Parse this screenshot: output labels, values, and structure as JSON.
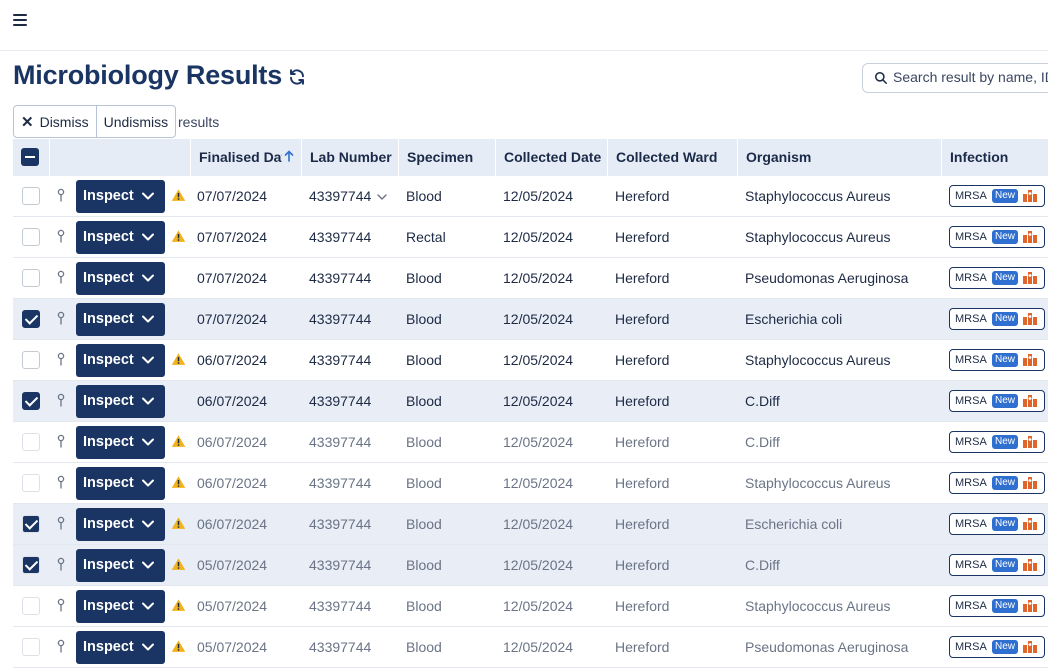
{
  "header": {
    "menu_icon": "hamburger-icon"
  },
  "page": {
    "title": "Microbiology Results",
    "refresh_icon": "refresh-icon"
  },
  "search": {
    "placeholder": "Search result by name, ID",
    "value": ""
  },
  "actions": {
    "dismiss_label": "Dismiss",
    "undismiss_label": "Undismiss",
    "results_label": "results"
  },
  "table": {
    "columns": [
      "Finalised Date",
      "Lab Number",
      "Specimen",
      "Collected Date",
      "Collected Ward",
      "Organism",
      "Infection"
    ],
    "inspect_label": "Inspect",
    "rows": [
      {
        "checked": false,
        "warning": true,
        "faded": false,
        "finalised": "07/07/2024",
        "lab": "43397744",
        "lab_dropdown": true,
        "specimen": "Blood",
        "collected": "12/05/2024",
        "ward": "Hereford",
        "organism": "Staphylococcus Aureus",
        "infection": "MRSA",
        "badge": "New"
      },
      {
        "checked": false,
        "warning": true,
        "faded": false,
        "finalised": "07/07/2024",
        "lab": "43397744",
        "lab_dropdown": false,
        "specimen": "Rectal",
        "collected": "12/05/2024",
        "ward": "Hereford",
        "organism": "Staphylococcus Aureus",
        "infection": "MRSA",
        "badge": "New"
      },
      {
        "checked": false,
        "warning": false,
        "faded": false,
        "finalised": "07/07/2024",
        "lab": "43397744",
        "lab_dropdown": false,
        "specimen": "Blood",
        "collected": "12/05/2024",
        "ward": "Hereford",
        "organism": "Pseudomonas Aeruginosa",
        "infection": "MRSA",
        "badge": "New"
      },
      {
        "checked": true,
        "warning": false,
        "faded": false,
        "finalised": "07/07/2024",
        "lab": "43397744",
        "lab_dropdown": false,
        "specimen": "Blood",
        "collected": "12/05/2024",
        "ward": "Hereford",
        "organism": "Escherichia coli",
        "infection": "MRSA",
        "badge": "New"
      },
      {
        "checked": false,
        "warning": true,
        "faded": false,
        "finalised": "06/07/2024",
        "lab": "43397744",
        "lab_dropdown": false,
        "specimen": "Blood",
        "collected": "12/05/2024",
        "ward": "Hereford",
        "organism": "Staphylococcus Aureus",
        "infection": "MRSA",
        "badge": "New"
      },
      {
        "checked": true,
        "warning": false,
        "faded": false,
        "finalised": "06/07/2024",
        "lab": "43397744",
        "lab_dropdown": false,
        "specimen": "Blood",
        "collected": "12/05/2024",
        "ward": "Hereford",
        "organism": "C.Diff",
        "infection": "MRSA",
        "badge": "New"
      },
      {
        "checked": false,
        "warning": true,
        "faded": true,
        "finalised": "06/07/2024",
        "lab": "43397744",
        "lab_dropdown": false,
        "specimen": "Blood",
        "collected": "12/05/2024",
        "ward": "Hereford",
        "organism": "C.Diff",
        "infection": "MRSA",
        "badge": "New"
      },
      {
        "checked": false,
        "warning": true,
        "faded": true,
        "finalised": "06/07/2024",
        "lab": "43397744",
        "lab_dropdown": false,
        "specimen": "Blood",
        "collected": "12/05/2024",
        "ward": "Hereford",
        "organism": "Staphylococcus Aureus",
        "infection": "MRSA",
        "badge": "New"
      },
      {
        "checked": true,
        "warning": true,
        "faded": true,
        "finalised": "06/07/2024",
        "lab": "43397744",
        "lab_dropdown": false,
        "specimen": "Blood",
        "collected": "12/05/2024",
        "ward": "Hereford",
        "organism": "Escherichia coli",
        "infection": "MRSA",
        "badge": "New"
      },
      {
        "checked": true,
        "warning": true,
        "faded": true,
        "finalised": "05/07/2024",
        "lab": "43397744",
        "lab_dropdown": false,
        "specimen": "Blood",
        "collected": "12/05/2024",
        "ward": "Hereford",
        "organism": "C.Diff",
        "infection": "MRSA",
        "badge": "New"
      },
      {
        "checked": false,
        "warning": true,
        "faded": true,
        "finalised": "05/07/2024",
        "lab": "43397744",
        "lab_dropdown": false,
        "specimen": "Blood",
        "collected": "12/05/2024",
        "ward": "Hereford",
        "organism": "Staphylococcus Aureus",
        "infection": "MRSA",
        "badge": "New"
      },
      {
        "checked": false,
        "warning": true,
        "faded": true,
        "finalised": "05/07/2024",
        "lab": "43397744",
        "lab_dropdown": false,
        "specimen": "Blood",
        "collected": "12/05/2024",
        "ward": "Hereford",
        "organism": "Pseudomonas Aeruginosa",
        "infection": "MRSA",
        "badge": "New"
      }
    ]
  },
  "colors": {
    "primary": "#1a3563",
    "header_bg": "#e6ecf5",
    "selected_row": "#e8edf6",
    "warning": "#f2b21c",
    "badge_new": "#2f6fd0",
    "icon_orange": "#e0652b"
  }
}
